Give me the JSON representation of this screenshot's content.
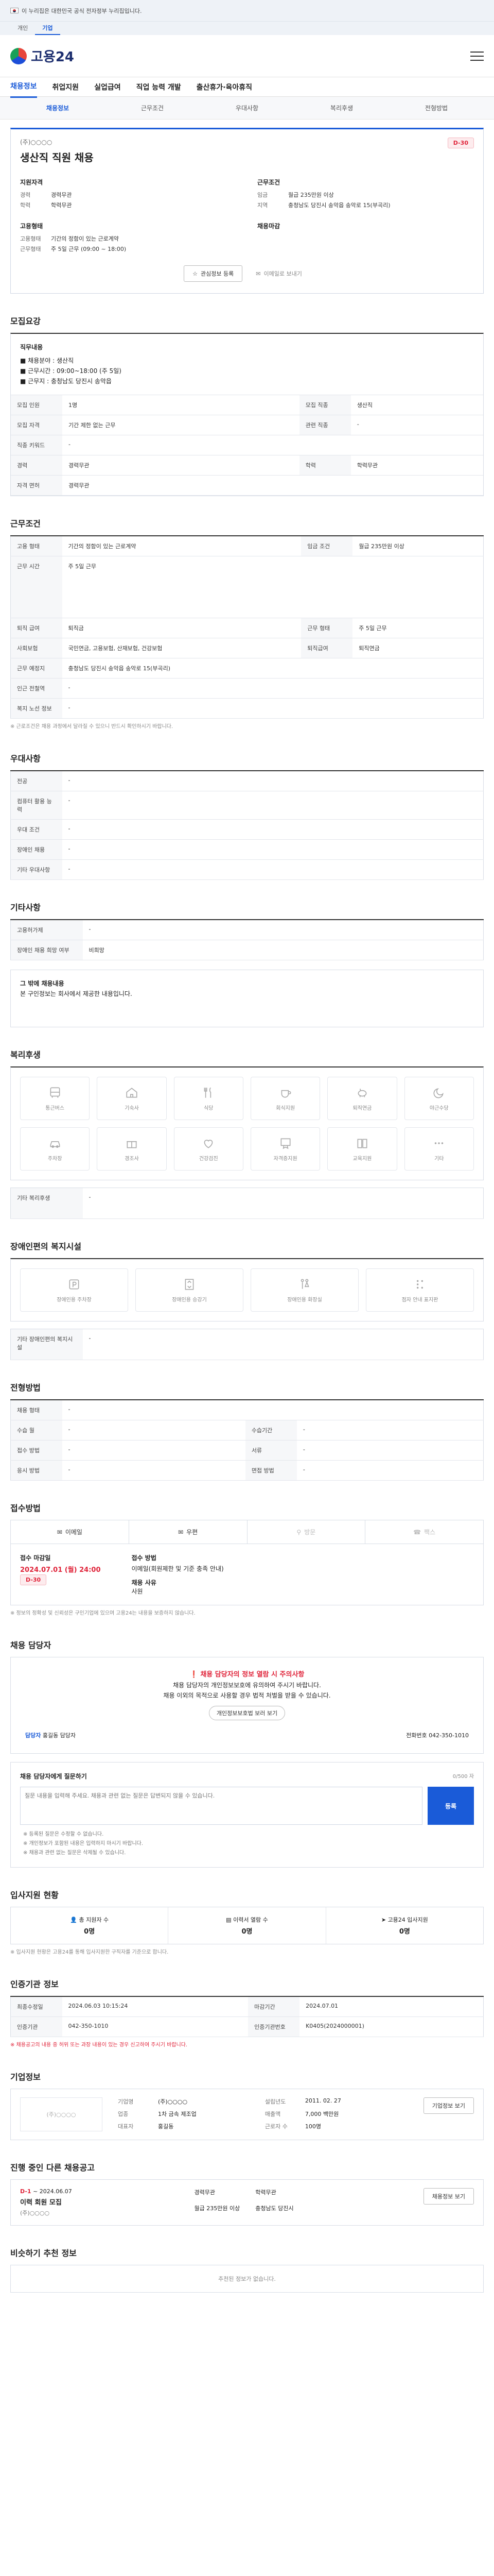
{
  "gov_banner": {
    "text": "이 누리집은 대한민국 공식 전자정부 누리집입니다.",
    "tabs": [
      "개인",
      "기업"
    ]
  },
  "header": {
    "logo": "고용24"
  },
  "gnb": [
    "채용정보",
    "취업지원",
    "실업급여",
    "직업 능력 개발",
    "출산휴가·육아휴직"
  ],
  "lnb": [
    "채용정보",
    "근무조건",
    "우대사항",
    "복리후생",
    "전형방법"
  ],
  "job": {
    "company": "(주)○○○○",
    "title": "생산직 직원 채용",
    "dday": "D-30",
    "left_heading1": "지원자격",
    "left1": [
      {
        "k": "경력",
        "v": "경력무관"
      },
      {
        "k": "학력",
        "v": "학력무관"
      }
    ],
    "left_heading2": "고용형태",
    "left2": [
      {
        "k": "고용형태",
        "v": "기간의 정함이 있는 근로계약"
      },
      {
        "k": "근무형태",
        "v": "주 5일 근무 (09:00 ~ 18:00)"
      }
    ],
    "right_heading1": "근무조건",
    "right1": [
      {
        "k": "임금",
        "v": "월급 235만원 이상"
      },
      {
        "k": "지역",
        "v": "충청남도 당진시 송악읍 송악로 15(부곡리)"
      }
    ],
    "right_heading2": "채용마감",
    "actions": {
      "scrap": "관심정보 등록",
      "share": "이메일로 보내기"
    }
  },
  "sections": {
    "recruit_title": "모집요강",
    "recruit_intro_title": "직무내용",
    "recruit_intro": [
      "■ 채용분야 : 생산직",
      "■ 근무시간 : 09:00~18:00 (주 5일)",
      "■ 근무지 : 충청남도 당진시 송악읍"
    ],
    "recruit_rows": [
      {
        "k": "모집 인원",
        "v": "1명",
        "k2": "모집 직종",
        "v2": "생산직"
      },
      {
        "k": "모집 자격",
        "v": "기간 제한 없는 근무",
        "k2": "관련 직종",
        "v2": "-"
      },
      {
        "k": "직종 키워드",
        "v": "-",
        "k2": "",
        "v2": ""
      },
      {
        "k": "경력",
        "v": "경력무관",
        "k2": "학력",
        "v2": "학력무관"
      },
      {
        "k": "자격 면허",
        "v": "경력무관",
        "k2": "",
        "v2": ""
      }
    ],
    "work_title": "근무조건",
    "work_rows": [
      {
        "k": "고용 형태",
        "v": "기간의 정함이 있는 근로계약",
        "k2": "임금 조건",
        "v2": "월급 235만원 이상"
      },
      {
        "k": "근무 시간",
        "v": "주 5일 근무",
        "k2": "",
        "v2": ""
      },
      {
        "k": "퇴직 급여",
        "v": "퇴직금",
        "k2": "근무 형태",
        "v2": "주 5일 근무"
      },
      {
        "k": "사회보험",
        "v": "국민연금, 고용보험, 산재보험, 건강보험",
        "k2": "퇴직급여",
        "v2": "퇴직연금"
      },
      {
        "k": "근무 예정지",
        "v": "충청남도 당진시 송악읍 송악로 15(부곡리)",
        "k2": "",
        "v2": ""
      },
      {
        "k": "인근 전철역",
        "v": "-",
        "k2": "",
        "v2": ""
      },
      {
        "k": "복지 노선 정보",
        "v": "-",
        "k2": "",
        "v2": ""
      }
    ],
    "work_note": "※ 근로조건은 채용 과정에서 달라질 수 있으니 반드시 확인하시기 바랍니다.",
    "pref_title": "우대사항",
    "pref_rows": [
      {
        "k": "전공",
        "v": "-"
      },
      {
        "k": "컴퓨터 활용 능력",
        "v": "-"
      },
      {
        "k": "우대 조건",
        "v": "-"
      },
      {
        "k": "장애인 채용",
        "v": "-"
      },
      {
        "k": "기타 우대사항",
        "v": "-"
      }
    ],
    "etc_title": "기타사항",
    "etc_rows": [
      {
        "k": "고용허가제",
        "v": "-"
      },
      {
        "k": "장애인 채용 희망 여부",
        "v": "비희망"
      }
    ],
    "etc_note_title": "그 밖에 채용내용",
    "etc_note": "본 구인정보는 회사에서 제공한 내용입니다.",
    "welfare_title": "복리후생",
    "welfare_items": [
      "통근버스",
      "기숙사",
      "식당",
      "회식지원",
      "퇴직연금",
      "야근수당",
      "주차장",
      "경조사",
      "건강검진",
      "자격증지원",
      "교육지원",
      "기타"
    ],
    "welfare_etc_label": "기타 복리후생",
    "welfare_etc_value": "-",
    "disabled_title": "장애인편의 복지시설",
    "disabled_items": [
      "장애인용 주차장",
      "장애인용 승강기",
      "장애인용 화장실",
      "점자 안내 표지판"
    ],
    "disabled_etc_label": "기타 장애인편의 복지시설",
    "disabled_etc_value": "-",
    "process_title": "전형방법",
    "process_rows": [
      {
        "k": "채용 형태",
        "v": "-",
        "k2": "",
        "v2": ""
      },
      {
        "k": "수습 월",
        "v": "-",
        "k2": "수습기간",
        "v2": "-"
      },
      {
        "k": "접수 방법",
        "v": "-",
        "k2": "서류",
        "v2": "-"
      },
      {
        "k": "응시 방법",
        "v": "-",
        "k2": "면접 방법",
        "v2": "-"
      }
    ],
    "apply_title": "접수방법",
    "apply_tabs": [
      "이메일",
      "우편",
      "방문",
      "팩스"
    ],
    "apply_deadline_label": "접수 마감일",
    "apply_deadline": "2024.07.01 (월) 24:00",
    "apply_dday": "D-30",
    "apply_method_label": "접수 방법",
    "apply_method": "이메일(회원제한 및 기준 충족 안내)",
    "apply_type_label": "채용 사유",
    "apply_type": "사원",
    "apply_note": "※ 정보의 정확성 및 신뢰성은 구인기업에 있으며 고용24는 내용을 보증하지 않습니다.",
    "contact_title": "채용 담당자",
    "contact_warn": "채용 담당자의 정보 열람 시 주의사항",
    "contact_desc1": "채용 담당자의 개인정보보호에 유의하여 주시기 바랍니다.",
    "contact_desc2": "채용 이외의 목적으로 사용할 경우 법적 처벌을 받을 수 있습니다.",
    "contact_btn": "개인정보보호법 보러 보기",
    "contact_name_label": "담당자",
    "contact_name": "홍길동 담당자",
    "contact_phone": "전화번호 042-350-1010",
    "inquiry_title": "채용 담당자에게 질문하기",
    "inquiry_sub": "0/500 자",
    "inquiry_placeholder": "질문 내용을 입력해 주세요. 채용과 관련 없는 질문은 답변되지 않을 수 있습니다.",
    "inquiry_btn": "등록",
    "inquiry_list": [
      "※ 등록된 질문은 수정할 수 없습니다.",
      "※ 개인정보가 포함된 내용은 입력하지 마시기 바랍니다.",
      "※ 채용과 관련 없는 질문은 삭제될 수 있습니다."
    ],
    "stats_title": "입사지원 현황",
    "stats": [
      {
        "label": "총 지원자 수",
        "value": "0명"
      },
      {
        "label": "이력서 열람 수",
        "value": "0명"
      },
      {
        "label": "고용24 입사지원",
        "value": "0명"
      }
    ],
    "stats_note": "※ 입사지원 현황은 고용24를 통해 입사지원한 구직자를 기준으로 합니다.",
    "notice_title": "인증기관 정보",
    "notice_rows": [
      {
        "k": "최종수정일",
        "v": "2024.06.03 10:15:24",
        "k2": "마감기간",
        "v2": "2024.07.01"
      },
      {
        "k": "인증기관",
        "v": "042-350-1010",
        "k2": "인증기관번호",
        "v2": "K0405(2024000001)"
      }
    ],
    "notice_note": "※ 채용공고의 내용 중 허위 또는 과장 내용이 있는 경우 신고하여 주시기 바랍니다.",
    "corp_title": "기업정보",
    "corp_logo": "(주)○○○○",
    "corp": [
      {
        "k": "기업명",
        "v": "(주)○○○○"
      },
      {
        "k": "설립년도",
        "v": "2011. 02. 27"
      },
      {
        "k": "업종",
        "v": "1차 금속 제조업"
      },
      {
        "k": "매출액",
        "v": "7,000 백만원"
      },
      {
        "k": "대표자",
        "v": "홍길동"
      },
      {
        "k": "근로자 수",
        "v": "100명"
      }
    ],
    "corp_btn": "기업정보 보기",
    "other_title": "진행 중인 다른 채용공고",
    "other_company": "(주)○○○○",
    "other_dday": "D-1",
    "other_date": "~ 2024.06.07",
    "other_job_title": "이력 회원 모집",
    "other_meta": [
      "경력무관",
      "학력무관",
      "월급 235만원 이상",
      "충청남도 당진시"
    ],
    "other_btn": "채용정보 보기",
    "recommend_title": "비슷하기 추천 정보",
    "recommend_empty": "추천된 정보가 없습니다."
  }
}
